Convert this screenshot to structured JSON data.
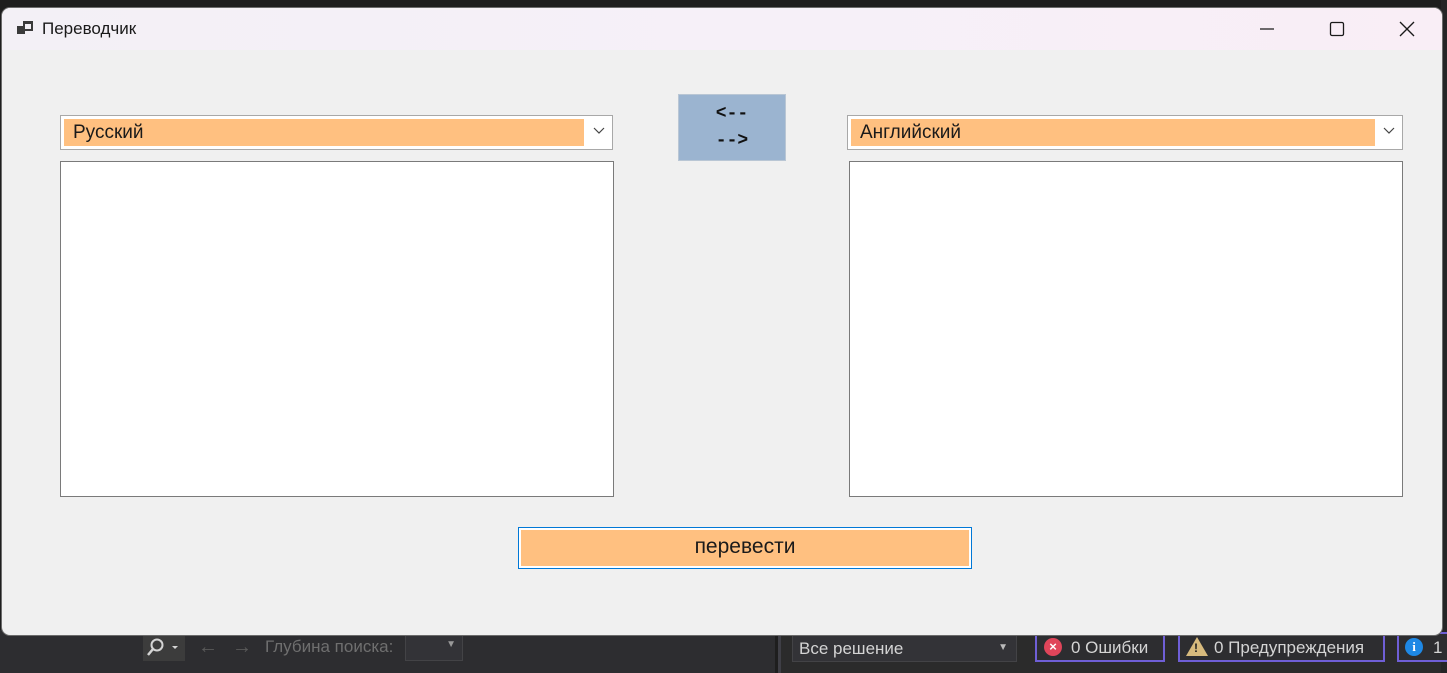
{
  "window": {
    "title": "Переводчик",
    "icon": "app-window-icon"
  },
  "titlebar_buttons": [
    "minimize-icon",
    "maximize-icon",
    "close-icon"
  ],
  "source_language": {
    "selected": "Русский",
    "text": ""
  },
  "target_language": {
    "selected": "Английский",
    "text": ""
  },
  "swap_button": {
    "line1": "<--",
    "line2": "-->"
  },
  "translate_button": {
    "label": "перевести"
  },
  "colors": {
    "accent": "#ffc080",
    "swap_button": "#9bb4d0",
    "window_bg": "#f0f0f0",
    "focus_border": "#0078d7"
  },
  "background_ide": {
    "search_depth_label": "Глубина поиска:",
    "scope": "Все решение",
    "errors": "0 Ошибки",
    "warnings": "0 Предупреждения",
    "messages": "1"
  }
}
